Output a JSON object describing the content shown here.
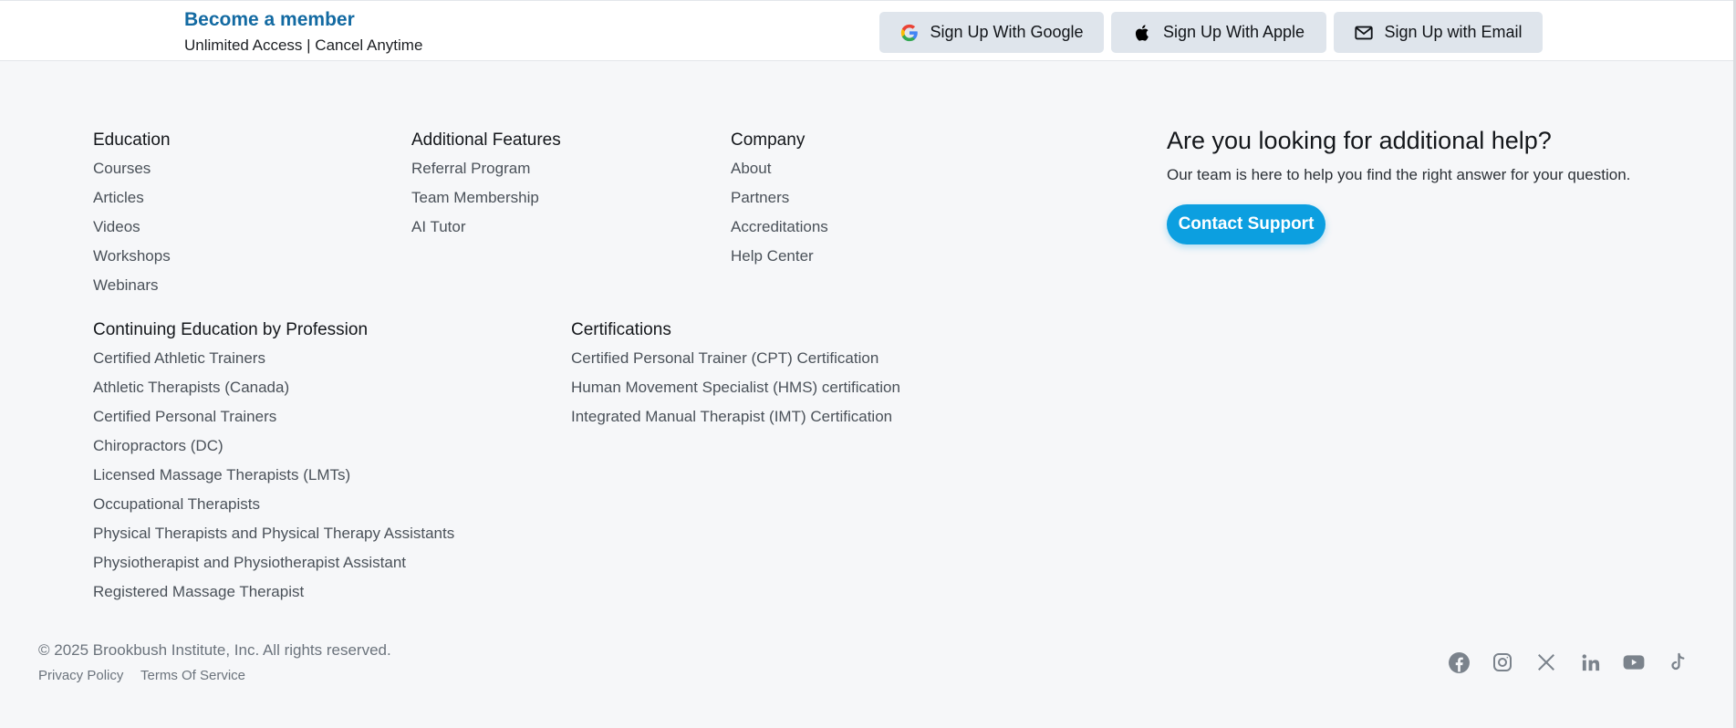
{
  "banner": {
    "title": "Become a member",
    "subtitle": "Unlimited Access | Cancel Anytime",
    "buttons": [
      {
        "label": "Sign Up With Google",
        "icon": "google-icon"
      },
      {
        "label": "Sign Up With Apple",
        "icon": "apple-icon"
      },
      {
        "label": "Sign Up with Email",
        "icon": "mail-icon"
      }
    ]
  },
  "education": {
    "heading": "Education",
    "links": [
      "Courses",
      "Articles",
      "Videos",
      "Workshops",
      "Webinars"
    ]
  },
  "additional_features": {
    "heading": "Additional Features",
    "links": [
      "Referral Program",
      "Team Membership",
      "AI Tutor"
    ]
  },
  "company": {
    "heading": "Company",
    "links": [
      "About",
      "Partners",
      "Accreditations",
      "Help Center"
    ]
  },
  "help": {
    "title": "Are you looking for additional help?",
    "text": "Our team is here to help you find the right answer for your question.",
    "button": "Contact Support"
  },
  "profession": {
    "heading": "Continuing Education by Profession",
    "links": [
      "Certified Athletic Trainers",
      "Athletic Therapists (Canada)",
      "Certified Personal Trainers",
      "Chiropractors (DC)",
      "Licensed Massage Therapists (LMTs)",
      "Occupational Therapists",
      "Physical Therapists and Physical Therapy Assistants",
      "Physiotherapist and Physiotherapist Assistant",
      "Registered Massage Therapist"
    ]
  },
  "certifications": {
    "heading": "Certifications",
    "links": [
      "Certified Personal Trainer (CPT) Certification",
      "Human Movement Specialist (HMS) certification",
      "Integrated Manual Therapist (IMT) Certification"
    ]
  },
  "footer": {
    "copyright": "© 2025 Brookbush Institute, Inc. All rights reserved.",
    "privacy": "Privacy Policy",
    "terms": "Terms Of Service",
    "social": [
      "facebook-icon",
      "instagram-icon",
      "x-icon",
      "linkedin-icon",
      "youtube-icon",
      "tiktok-icon"
    ]
  },
  "colors": {
    "brand_blue": "#136aa2",
    "cta": "#0c9fe0",
    "background": "#f6f7f9",
    "button_bg": "#dfe5ec",
    "icon_gray": "#7b838c"
  }
}
